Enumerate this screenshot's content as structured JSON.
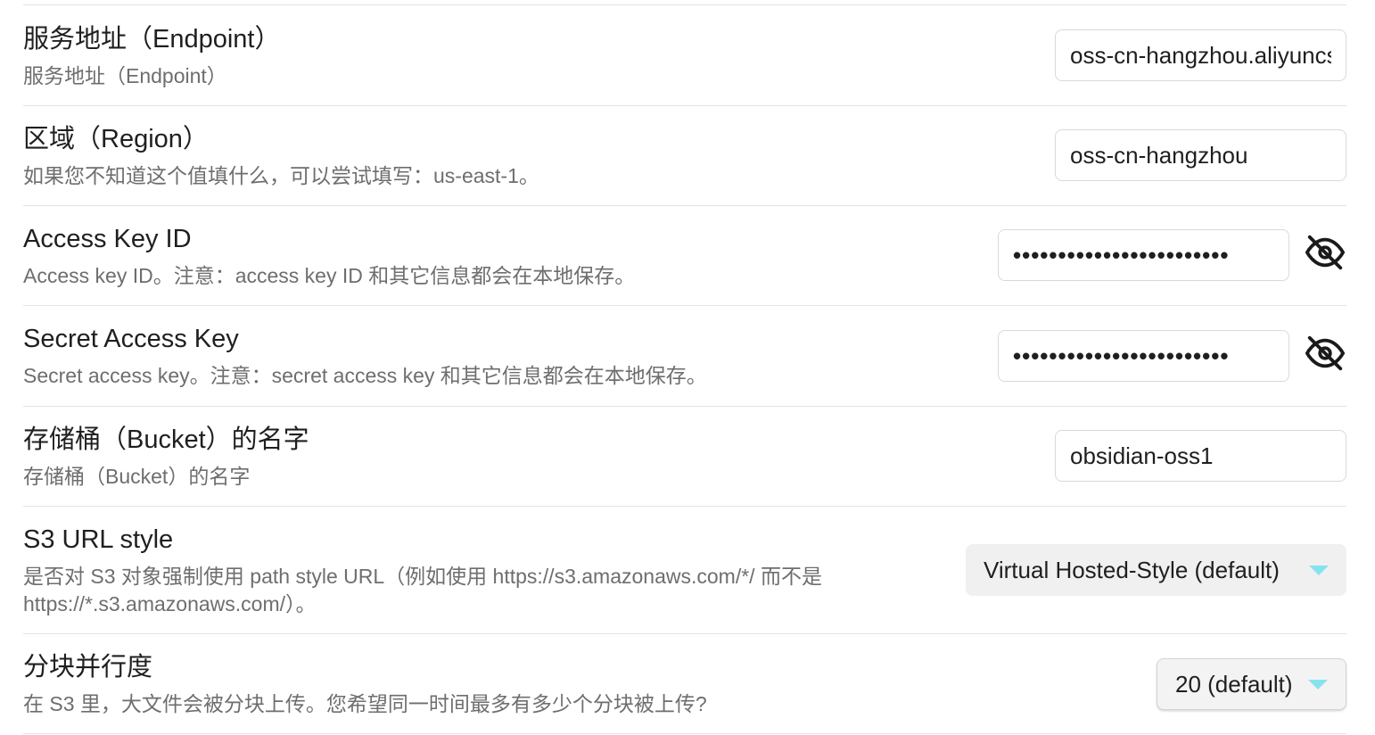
{
  "settings": [
    {
      "name": "服务地址（Endpoint）",
      "desc": "服务地址（Endpoint）",
      "value": "oss-cn-hangzhou.aliyuncs.com"
    },
    {
      "name": "区域（Region）",
      "desc": "如果您不知道这个值填什么，可以尝试填写：us-east-1。",
      "value": "oss-cn-hangzhou"
    },
    {
      "name": "Access Key ID",
      "desc": "Access key ID。注意：access key ID 和其它信息都会在本地保存。",
      "value": "••••••••••••••••••••••••",
      "icon": "eye-off-icon"
    },
    {
      "name": "Secret Access Key",
      "desc": "Secret access key。注意：secret access key 和其它信息都会在本地保存。",
      "value": "••••••••••••••••••••••••",
      "icon": "eye-off-icon"
    },
    {
      "name": "存储桶（Bucket）的名字",
      "desc": "存储桶（Bucket）的名字",
      "value": "obsidian-oss1"
    },
    {
      "name": "S3 URL style",
      "desc_line1": "是否对 S3 对象强制使用 path style URL（例如使用 https://s3.amazonaws.com/*/ 而不是",
      "desc_line2": "https://*.s3.amazonaws.com/）。",
      "selected": "Virtual Hosted-Style (default)"
    },
    {
      "name": "分块并行度",
      "desc": "在 S3 里，大文件会被分块上传。您希望同一时间最多有多少个分块被上传?",
      "selected": "20 (default)"
    }
  ],
  "colors": {
    "accent_chevron": "#86e3ee",
    "divider": "#e3e3e3",
    "description_text": "#6e6e6e"
  }
}
